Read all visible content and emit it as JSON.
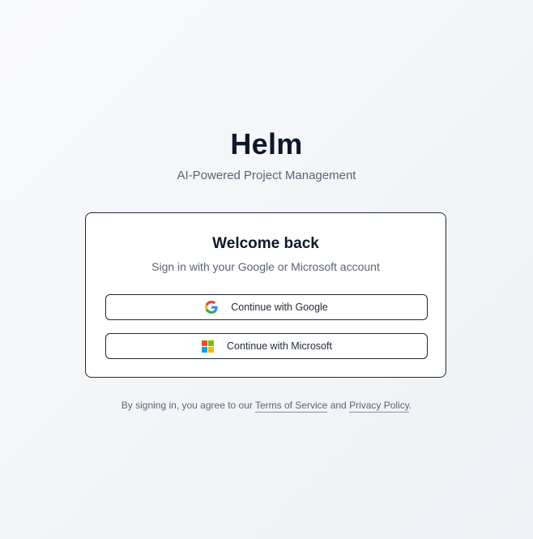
{
  "brand": {
    "title": "Helm",
    "subtitle": "AI-Powered Project Management"
  },
  "card": {
    "title": "Welcome back",
    "subtitle": "Sign in with your Google or Microsoft account",
    "buttons": [
      {
        "label": "Continue with Google",
        "icon": "google-icon"
      },
      {
        "label": "Continue with Microsoft",
        "icon": "microsoft-icon"
      }
    ]
  },
  "legal": {
    "prefix": "By signing in, you agree to our ",
    "terms_link": "Terms of Service",
    "conjunction": " and ",
    "privacy_link": "Privacy Policy",
    "suffix": "."
  },
  "colors": {
    "text_primary": "#0f172a",
    "text_muted": "#5b6475",
    "border": "#1f2937",
    "google_blue": "#4285F4",
    "google_red": "#EA4335",
    "google_yellow": "#FBBC05",
    "google_green": "#34A853",
    "ms_red": "#F25022",
    "ms_green": "#7FBA00",
    "ms_blue": "#00A4EF",
    "ms_yellow": "#FFB900"
  }
}
